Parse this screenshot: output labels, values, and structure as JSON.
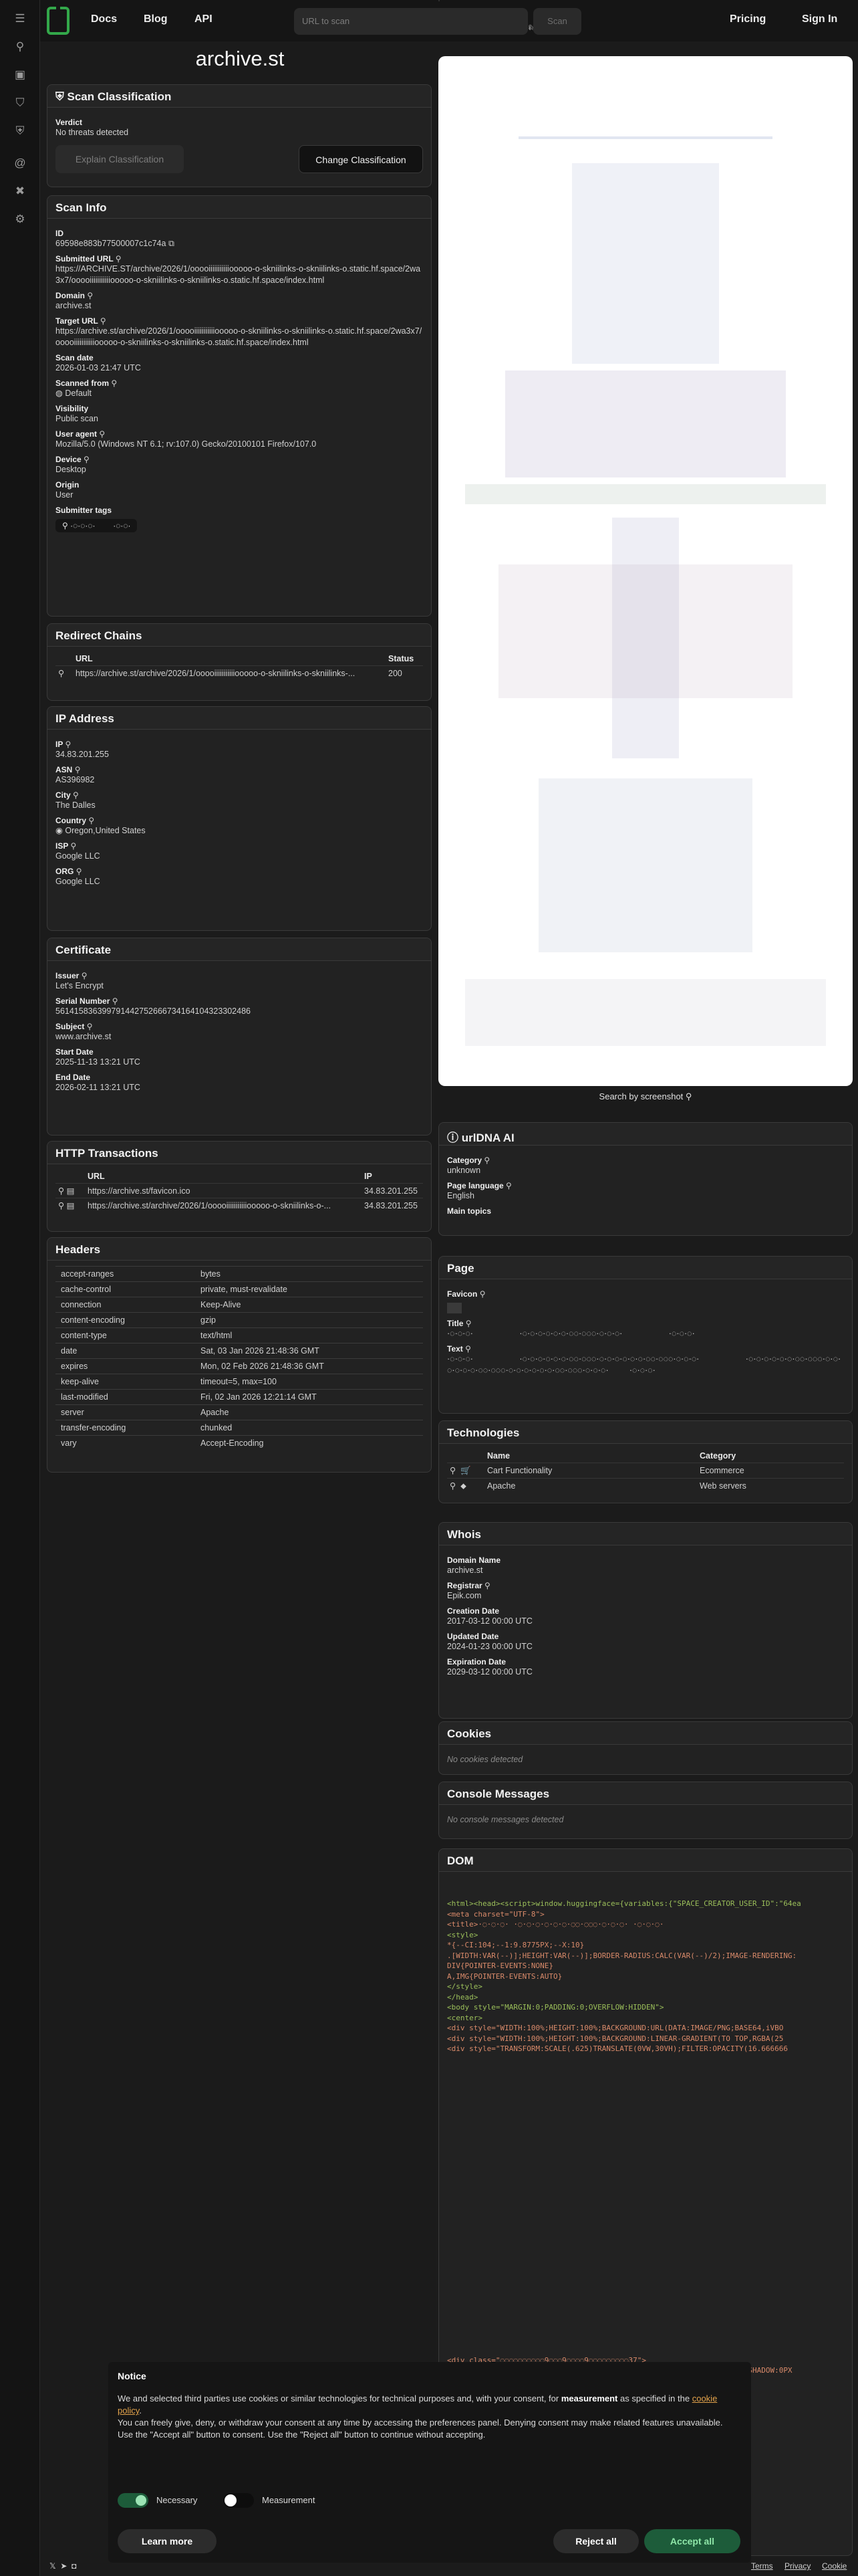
{
  "nav": {
    "docs": "Docs",
    "blog": "Blog",
    "api": "API",
    "pricing": "Pricing",
    "signin": "Sign In"
  },
  "search": {
    "placeholder": "URL to scan",
    "scan_label": "Scan"
  },
  "rail_icons": [
    "search-icon",
    "inbox-icon",
    "shield-check-icon",
    "shield-icon",
    "at-sign-icon",
    "radar-icon",
    "tools-icon",
    "settings-icon"
  ],
  "page_title": "archive.st",
  "scan_classification": {
    "title": "Scan Classification",
    "verdict_label": "Verdict",
    "verdict": "No threats detected",
    "explain_button": "Explain Classification",
    "change_button": "Change Classification"
  },
  "scan_info": {
    "title": "Scan Info",
    "id_label": "ID",
    "id": "69598e883b77500007c1c74a",
    "submitted_url_label": "Submitted URL",
    "submitted_url": "https://ARCHIVE.ST/archive/2026/1/ooooiiiiiiiiiiiooooo-o-skniilinks-o-skniilinks-o.static.hf.space/2wa3x7/ooooiiiiiiiiiiiooooo-o-skniilinks-o-skniilinks-o.static.hf.space/index.html",
    "domain_label": "Domain",
    "domain": "archive.st",
    "target_url_label": "Target URL",
    "target_url": "https://archive.st/archive/2026/1/ooooiiiiiiiiiiiooooo-o-skniilinks-o-skniilinks-o.static.hf.space/2wa3x7/ooooiiiiiiiiiiiooooo-o-skniilinks-o-skniilinks-o.static.hf.space/index.html",
    "scan_date_label": "Scan date",
    "scan_date": "2026-01-03 21:47 UTC",
    "scanned_from_label": "Scanned from",
    "scanned_from": "Default",
    "visibility_label": "Visibility",
    "visibility": "Public scan",
    "user_agent_label": "User agent",
    "user_agent": "Mozilla/5.0 (Windows NT 6.1; rv:107.0) Gecko/20100101 Firefox/107.0",
    "device_label": "Device",
    "device": "Desktop",
    "origin_label": "Origin",
    "origin": "User",
    "submitter_tags_label": "Submitter tags",
    "tags": [
      "·◌·◌·◌·",
      "·◌·◌·"
    ]
  },
  "redirect_chains": {
    "title": "Redirect Chains",
    "col_url": "URL",
    "col_status": "Status",
    "rows": [
      {
        "url": "https://archive.st/archive/2026/1/ooooiiiiiiiiiiiooooo-o-skniilinks-o-skniilinks-...",
        "status": "200"
      }
    ]
  },
  "ip_address": {
    "title": "IP Address",
    "ip_label": "IP",
    "ip": "34.83.201.255",
    "asn_label": "ASN",
    "asn": "AS396982",
    "city_label": "City",
    "city": "The Dalles",
    "country_label": "Country",
    "country": "Oregon,United States",
    "isp_label": "ISP",
    "isp": "Google LLC",
    "org_label": "ORG",
    "org": "Google LLC"
  },
  "certificate": {
    "title": "Certificate",
    "issuer_label": "Issuer",
    "issuer": "Let's Encrypt",
    "serial_label": "Serial Number",
    "serial": "561415836399791442752666734164104323302486",
    "subject_label": "Subject",
    "subject": "www.archive.st",
    "start_label": "Start Date",
    "start": "2025-11-13 13:21 UTC",
    "end_label": "End Date",
    "end": "2026-02-11 13:21 UTC"
  },
  "http_transactions": {
    "title": "HTTP Transactions",
    "col_url": "URL",
    "col_ip": "IP",
    "rows": [
      {
        "url": "https://archive.st/favicon.ico",
        "ip": "34.83.201.255"
      },
      {
        "url": "https://archive.st/archive/2026/1/ooooiiiiiiiiiiiooooo-o-skniilinks-o-...",
        "ip": "34.83.201.255"
      }
    ]
  },
  "headers": {
    "title": "Headers",
    "rows": [
      {
        "k": "accept-ranges",
        "v": "bytes"
      },
      {
        "k": "cache-control",
        "v": "private, must-revalidate"
      },
      {
        "k": "connection",
        "v": "Keep-Alive"
      },
      {
        "k": "content-encoding",
        "v": "gzip"
      },
      {
        "k": "content-type",
        "v": "text/html"
      },
      {
        "k": "date",
        "v": "Sat, 03 Jan 2026 21:48:36 GMT"
      },
      {
        "k": "expires",
        "v": "Mon, 02 Feb 2026 21:48:36 GMT"
      },
      {
        "k": "keep-alive",
        "v": "timeout=5, max=100"
      },
      {
        "k": "last-modified",
        "v": "Fri, 02 Jan 2026 12:21:14 GMT"
      },
      {
        "k": "server",
        "v": "Apache"
      },
      {
        "k": "transfer-encoding",
        "v": "chunked"
      },
      {
        "k": "vary",
        "v": "Accept-Encoding"
      }
    ]
  },
  "screenshot": {
    "caption": "Search by screenshot"
  },
  "urldna_ai": {
    "title": "urlDNA AI",
    "category_label": "Category",
    "category": "unknown",
    "language_label": "Page language",
    "language": "English",
    "topics_label": "Main topics"
  },
  "page": {
    "title": "Page",
    "favicon_label": "Favicon",
    "title_label": "Title",
    "title_value": "·◌·◌·◌·                    ·◌·◌·◌·◌·◌·◌·◌◌·◌◌◌·◌·◌·◌·                    ·◌·◌·◌·",
    "text_label": "Text",
    "text_value": "·◌·◌·◌·                    ·◌·◌·◌·◌·◌·◌·◌◌·◌◌◌·◌·◌·◌·◌·◌·◌·◌◌·◌◌◌·◌·◌·◌·                    ·◌·◌·◌·◌·◌·◌·◌◌·◌◌◌·◌·◌·◌·◌·◌·◌·◌◌·◌◌◌·◌·◌·◌·◌·◌·◌·◌◌·◌◌◌·◌·◌·◌·         ·◌·◌·◌·"
  },
  "technologies": {
    "title": "Technologies",
    "col_name": "Name",
    "col_category": "Category",
    "rows": [
      {
        "name": "Cart Functionality",
        "category": "Ecommerce",
        "icon": "cart-icon"
      },
      {
        "name": "Apache",
        "category": "Web servers",
        "icon": "apache-icon"
      }
    ]
  },
  "whois": {
    "title": "Whois",
    "domain_label": "Domain Name",
    "domain": "archive.st",
    "registrar_label": "Registrar",
    "registrar": "Epik.com",
    "creation_label": "Creation Date",
    "creation": "2017-03-12 00:00 UTC",
    "updated_label": "Updated Date",
    "updated": "2024-01-23 00:00 UTC",
    "expiration_label": "Expiration Date",
    "expiration": "2029-03-12 00:00 UTC"
  },
  "cookies": {
    "title": "Cookies",
    "empty": "No cookies detected"
  },
  "console": {
    "title": "Console Messages",
    "empty": "No console messages detected"
  },
  "dom": {
    "title": "DOM",
    "lines": [
      "<html><head><script>window.huggingface={variables:{\"SPACE_CREATOR_USER_ID\":\"64ea",
      "<meta charset=\"UTF-8\">",
      "<title>·◌·◌·◌·                    ·◌·◌·◌·◌·◌·◌·◌◌·◌◌◌·◌·◌·◌·                    ·◌·◌·◌·",
      "<style>",
      "*{--CI:104;--1:9.8775PX;--X:10}",
      ".[WIDTH:VAR(--)];HEIGHT:VAR(--)];BORDER-RADIUS:CALC(VAR(--)/2);IMAGE-RENDERING:",
      "DIV{POINTER-EVENTS:NONE}",
      "A,IMG{POINTER-EVENTS:AUTO}",
      "</style>",
      "</head>",
      "<body style=\"MARGIN:0;PADDING:0;OVERFLOW:HIDDEN\">",
      "<center>",
      "<div style=\"WIDTH:100%;HEIGHT:100%;BACKGROUND:URL(DATA:IMAGE/PNG;BASE64,iVBO",
      "<div style=\"WIDTH:100%;HEIGHT:100%;BACKGROUND:LINEAR-GRADIENT(TO TOP,RGBA(25",
      "<div style=\"TRANSFORM:SCALE(.625)TRANSLATE(0VW,30VH);FILTER:OPACITY(16.666666"
    ],
    "tail_lines": [
      "<div class=\"◌◌◌◌◌◌◌◌◌◌9◌◌◌9◌◌◌◌9◌◌◌◌◌◌◌◌◌37\">",
      "<div style=\"WIDTH:100%;HEIGHT:100%;POSITION:FIXED;TOP:0;LEFT:0;TEXT-SHADOW:0PX"
    ]
  },
  "cookie_banner": {
    "title": "Notice",
    "text1": "We and selected third parties use cookies or similar technologies for technical purposes and, with your consent, for",
    "text1_bold": "measurement",
    "text2": "as specified in the",
    "policy_link": "cookie policy",
    "text3": "You can freely give, deny, or withdraw your consent at any time by accessing the preferences panel. Denying consent may make related features unavailable.",
    "text4": "Use the \"Accept all\" button to consent. Use the \"Reject all\" button to continue without accepting.",
    "necessary_label": "Necessary",
    "measurement_label": "Measurement",
    "learn_more": "Learn more",
    "reject_all": "Reject all",
    "accept_all": "Accept all"
  },
  "footer": {
    "terms": "Terms",
    "privacy": "Privacy",
    "cookie": "Cookie"
  },
  "colors": {
    "accent": "#33a84a",
    "accept": "#1d5c3a",
    "panel": "#222222"
  }
}
